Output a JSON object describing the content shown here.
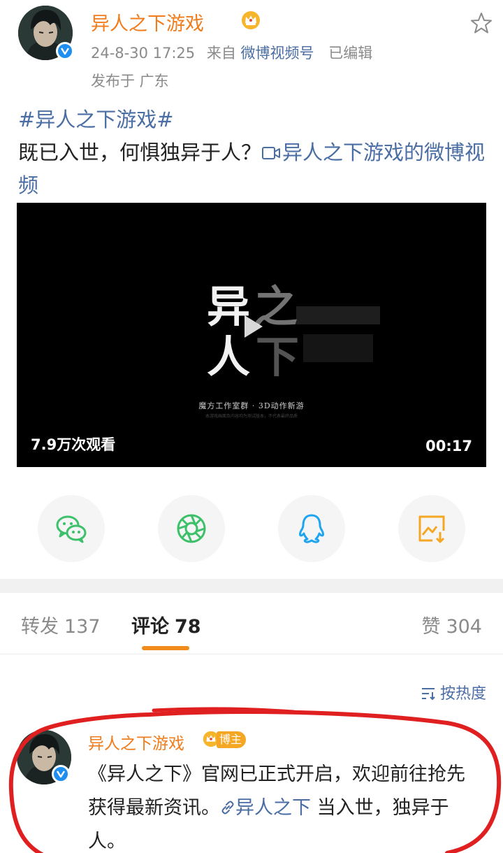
{
  "post": {
    "author": "异人之下游戏",
    "date": "24-8-30 17:25",
    "source_prefix": "来自",
    "source": "微博视频号",
    "edited": "已编辑",
    "location": "发布于 广东",
    "hashtag": "#异人之下游戏#",
    "text": "既已入世，何惧独异于人？",
    "video_link": "异人之下游戏的微博视频"
  },
  "video": {
    "title_art": "异人之下",
    "studio": "魔方工作室群 · 3D动作新游",
    "fine_print": "本游戏画面及内容均为测试版本，不代表最终品质",
    "views": "7.9万次观看",
    "duration": "00:17"
  },
  "share": [
    {
      "name": "wechat-icon",
      "color": "#3cc06a"
    },
    {
      "name": "moments-icon",
      "color": "#3cc06a"
    },
    {
      "name": "qq-icon",
      "color": "#1ea4f0"
    },
    {
      "name": "save-image-icon",
      "color": "#f5a623"
    }
  ],
  "tabs": {
    "repost_label": "转发",
    "repost_count": "137",
    "comment_label": "评论",
    "comment_count": "78",
    "like_label": "赞",
    "like_count": "304"
  },
  "sort_label": "按热度",
  "comment": {
    "author": "异人之下游戏",
    "badge": "博主",
    "text_a": "《异人之下》官网已正式开启，欢迎前往抢先获得最新资讯。",
    "link": "异人之下",
    "text_b": " 当入世，独异于人。"
  },
  "colors": {
    "accent": "#f07c1b",
    "link": "#4a6ea3",
    "verified": "#1e8ff0",
    "annotation": "#e02020"
  }
}
